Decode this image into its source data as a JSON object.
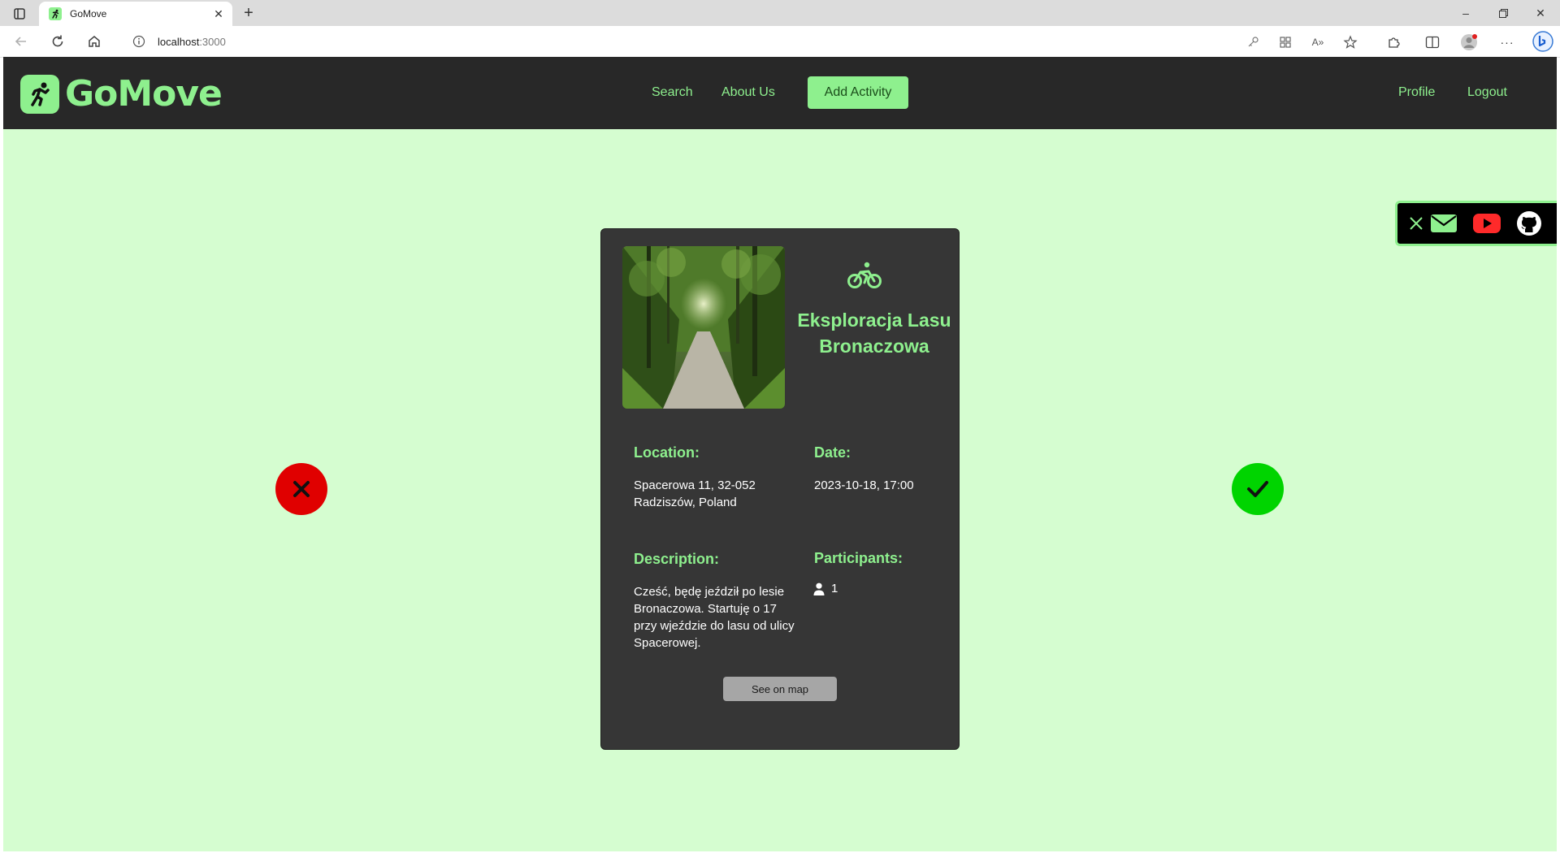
{
  "browser": {
    "tab_title": "GoMove",
    "url_host": "localhost",
    "url_port": ":3000"
  },
  "nav": {
    "brand": "GoMove",
    "links": {
      "search": "Search",
      "about": "About Us",
      "add_activity": "Add Activity",
      "profile": "Profile",
      "logout": "Logout"
    }
  },
  "activity": {
    "title": "Eksploracja Lasu Bronaczowa",
    "type_icon": "bicycle-icon",
    "location_label": "Location:",
    "location_line1": "Spacerowa 11, 32-052",
    "location_line2": "Radziszów, Poland",
    "date_label": "Date:",
    "date_value": "2023-10-18, 17:00",
    "description_label": "Description:",
    "description_text": "Cześć, będę jeździł po lesie Bronaczowa. Startuję o 17 przy wjeździe do lasu od ulicy Spacerowej.",
    "participants_label": "Participants:",
    "participants_count": "1",
    "map_button": "See on map"
  },
  "colors": {
    "accent": "#8ef08e",
    "page_bg": "#d5fdd0",
    "nav_bg": "#282828",
    "card_bg": "#363636",
    "reject": "#e00000",
    "accept": "#00d400",
    "youtube": "#ff2a2a"
  }
}
